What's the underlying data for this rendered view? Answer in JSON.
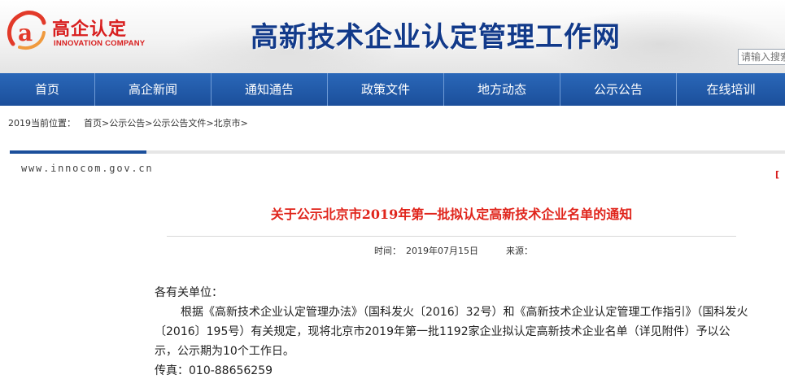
{
  "header": {
    "logo_cn": "高企认定",
    "logo_en": "INNOVATION COMPANY",
    "site_title": "高新技术企业认定管理工作网",
    "search_placeholder": "请输入搜索"
  },
  "nav": {
    "items": [
      {
        "label": "首页"
      },
      {
        "label": "高企新闻"
      },
      {
        "label": "通知通告"
      },
      {
        "label": "政策文件"
      },
      {
        "label": "地方动态"
      },
      {
        "label": "公示公告"
      },
      {
        "label": "在线培训"
      }
    ]
  },
  "breadcrumb": {
    "label": "2019当前位置：",
    "items": [
      "首页",
      "公示公告",
      "公示公告文件",
      "北京市"
    ],
    "separator": ">"
  },
  "page": {
    "domain": "www.innocom.gov.cn",
    "right_mark": "[",
    "accent_color": "#1b4f9b",
    "title_color": "#e0251c"
  },
  "article": {
    "title": "关于公示北京市2019年第一批拟认定高新技术企业名单的通知",
    "time_label": "时间：",
    "time_value": "2019年07月15日",
    "source_label": "来源：",
    "greeting": "各有关单位：",
    "paragraph": "根据《高新技术企业认定管理办法》（国科发火〔2016〕32号）和《高新技术企业认定管理工作指引》（国科发火〔2016〕195号）有关规定，现将北京市2019年第一批1192家企业拟认定高新技术企业名单（详见附件）予以公示，公示期为10个工作日。",
    "fax": "传真：010-88656259"
  }
}
